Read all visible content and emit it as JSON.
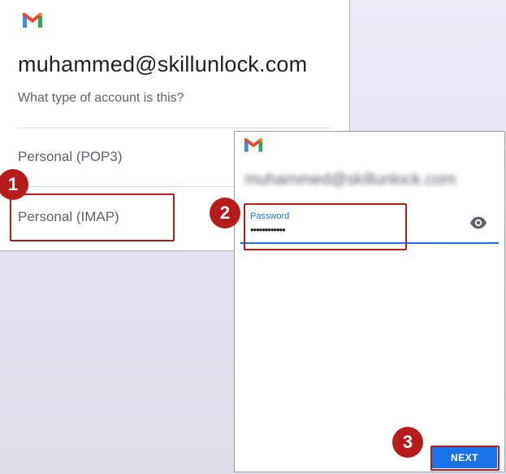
{
  "left_panel": {
    "email": "muhammed@skillunlock.com",
    "subtitle": "What type of account is this?",
    "options": [
      "Personal (POP3)",
      "Personal (IMAP)"
    ]
  },
  "right_panel": {
    "email_blurred": "muhammed@skillunlock.com",
    "password_label": "Password",
    "password_value": "••••••••••••",
    "next_label": "NEXT"
  },
  "steps": [
    "1",
    "2",
    "3"
  ],
  "colors": {
    "highlight": "#b71c1c",
    "accent": "#1a73e8",
    "badge": "#b71c1c"
  },
  "icons": [
    "gmail-logo",
    "eye-icon"
  ]
}
